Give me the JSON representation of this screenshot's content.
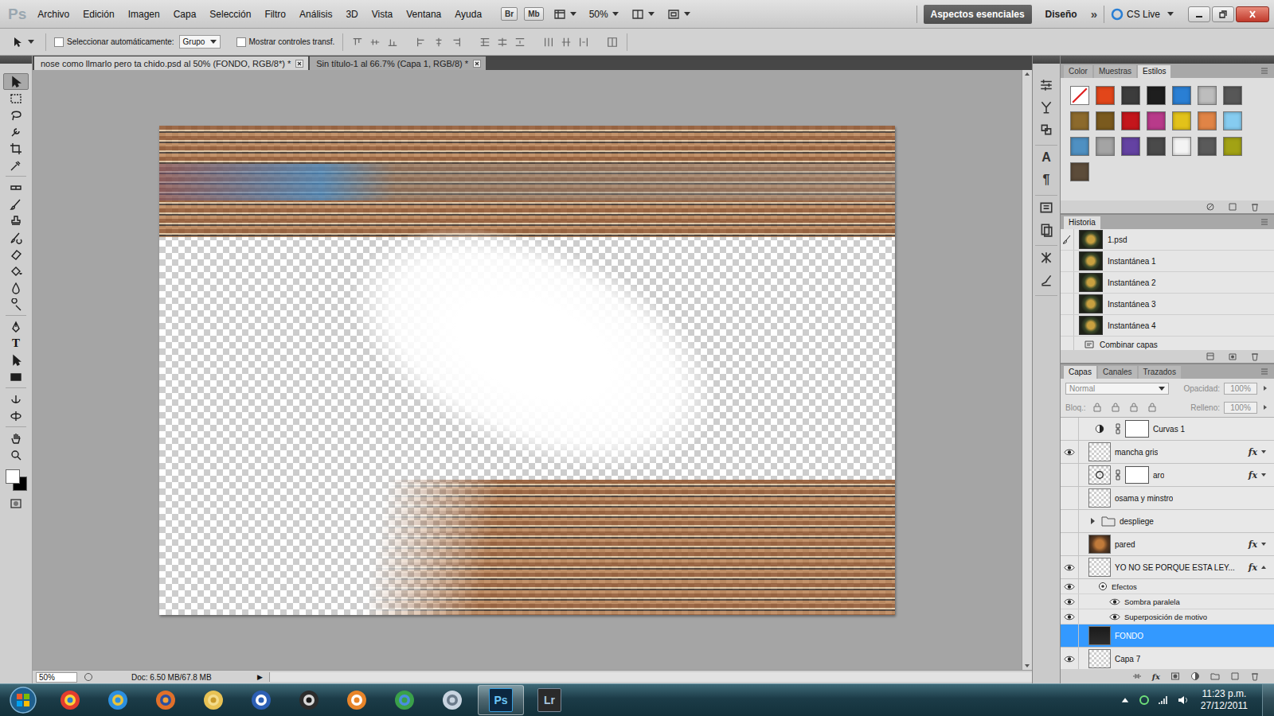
{
  "app": {
    "logo": "Ps"
  },
  "menu": [
    "Archivo",
    "Edición",
    "Imagen",
    "Capa",
    "Selección",
    "Filtro",
    "Análisis",
    "3D",
    "Vista",
    "Ventana",
    "Ayuda"
  ],
  "app_bar": {
    "bridge": "Br",
    "mini_bridge": "Mb",
    "zoom": "50%",
    "workspaces": [
      {
        "label": "Aspectos esenciales",
        "selected": true
      },
      {
        "label": "Diseño",
        "selected": false
      }
    ],
    "more": "»",
    "cs_live": "CS Live"
  },
  "options_bar": {
    "auto_select": {
      "label": "Seleccionar automáticamente:",
      "checked": false
    },
    "auto_select_target": "Grupo",
    "transform_controls": {
      "label": "Mostrar controles transf.",
      "checked": false
    }
  },
  "documents": [
    {
      "label": "nose como llmarlo pero ta chido.psd al 50% (FONDO, RGB/8*) *",
      "selected": true
    },
    {
      "label": "Sin título-1 al 66.7% (Capa 1, RGB/8) *",
      "selected": false
    }
  ],
  "toolbar": {
    "type_glyph": "T",
    "foreground": "#ffffff",
    "background": "#000000"
  },
  "status_bar": {
    "zoom": "50%",
    "doc": "Doc: 6.50 MB/67.8 MB",
    "menu": "▶"
  },
  "right_dock": {
    "glyphs": [
      "A",
      "¶"
    ]
  },
  "styles_panel": {
    "tabs": [
      {
        "label": "Color",
        "selected": false
      },
      {
        "label": "Muestras",
        "selected": false
      },
      {
        "label": "Estilos",
        "selected": true
      }
    ],
    "swatches": [
      {
        "kind": "none",
        "color": "#ffffff"
      },
      {
        "kind": "fill",
        "color": "#e2461a"
      },
      {
        "kind": "fill",
        "color": "#3c3c3c"
      },
      {
        "kind": "fill",
        "color": "#1e1e1e"
      },
      {
        "kind": "fill",
        "color": "#2a7fd4"
      },
      {
        "kind": "fill",
        "color": "#bdbdbd"
      },
      {
        "kind": "fill",
        "color": "#575757"
      },
      {
        "kind": "fill",
        "color": "#8c6a2c"
      },
      {
        "kind": "fill",
        "color": "#7a5a1e"
      },
      {
        "kind": "fill",
        "color": "#c4161c"
      },
      {
        "kind": "fill",
        "color": "#b83a8a"
      },
      {
        "kind": "fill",
        "color": "#e2c21a"
      },
      {
        "kind": "fill",
        "color": "#e08446"
      },
      {
        "kind": "fill",
        "color": "#86ccf0"
      },
      {
        "kind": "fill",
        "color": "#4f90c2"
      },
      {
        "kind": "fill",
        "color": "#a4a4a4"
      },
      {
        "kind": "fill",
        "color": "#6442a2"
      },
      {
        "kind": "fill",
        "color": "#4a4a4a"
      },
      {
        "kind": "fill",
        "color": "#f4f4f4"
      },
      {
        "kind": "fill",
        "color": "#5a5a5a"
      },
      {
        "kind": "fill",
        "color": "#a2a214"
      },
      {
        "kind": "fill",
        "color": "#5c4c3a"
      }
    ]
  },
  "history": {
    "title": "Historia",
    "items": [
      {
        "kind": "snapshot",
        "label": "1.psd",
        "source": true,
        "selected": false
      },
      {
        "kind": "snapshot",
        "label": "Instantánea 1",
        "source": false,
        "selected": false
      },
      {
        "kind": "snapshot",
        "label": "Instantánea 2",
        "source": false,
        "selected": false
      },
      {
        "kind": "snapshot",
        "label": "Instantánea 3",
        "source": false,
        "selected": false
      },
      {
        "kind": "snapshot",
        "label": "Instantánea 4",
        "source": false,
        "selected": false
      },
      {
        "kind": "step",
        "label": "Combinar capas",
        "source": false,
        "selected": false
      }
    ]
  },
  "layers_panel": {
    "tabs": [
      {
        "label": "Capas",
        "selected": true
      },
      {
        "label": "Canales",
        "selected": false
      },
      {
        "label": "Trazados",
        "selected": false
      }
    ],
    "blend_mode": {
      "value": "Normal",
      "disabled": true
    },
    "opacity": {
      "label": "Opacidad:",
      "value": "100%",
      "disabled": true
    },
    "lock": {
      "label": "Bloq.:"
    },
    "fill": {
      "label": "Relleno:",
      "value": "100%",
      "disabled": true
    },
    "fx_label": "fx",
    "layers": [
      {
        "kind": "adjustment",
        "name": "Curvas 1",
        "visible": false,
        "selected": false,
        "mask": true,
        "fx": false,
        "expanded": false,
        "thumb": "adjustment"
      },
      {
        "kind": "layer",
        "name": "mancha gris",
        "visible": true,
        "selected": false,
        "mask": false,
        "fx": true,
        "expanded": false,
        "thumb": "checker"
      },
      {
        "kind": "layer",
        "name": "aro",
        "visible": false,
        "selected": false,
        "mask": true,
        "fx": true,
        "expanded": false,
        "thumb": "ring"
      },
      {
        "kind": "layer",
        "name": "osama y minstro",
        "visible": false,
        "selected": false,
        "mask": false,
        "fx": false,
        "expanded": false,
        "thumb": "checker"
      },
      {
        "kind": "group",
        "name": "despliege",
        "visible": false,
        "selected": false,
        "mask": false,
        "fx": false,
        "expanded": false,
        "thumb": "folder"
      },
      {
        "kind": "layer",
        "name": "pared",
        "visible": false,
        "selected": false,
        "mask": false,
        "fx": true,
        "expanded": false,
        "thumb": "photo"
      },
      {
        "kind": "layer",
        "name": "YO NO SE PORQUE ESTA LEY...",
        "visible": true,
        "selected": false,
        "mask": false,
        "fx": true,
        "expanded": true,
        "thumb": "checker"
      },
      {
        "kind": "effects",
        "name": "Efectos",
        "visible": true,
        "selected": false,
        "mask": false,
        "fx": false,
        "expanded": true,
        "thumb": "none"
      },
      {
        "kind": "effect",
        "name": "Sombra paralela",
        "visible": true,
        "selected": false,
        "mask": false,
        "fx": false,
        "expanded": false,
        "thumb": "none"
      },
      {
        "kind": "effect",
        "name": "Superposición de motivo",
        "visible": true,
        "selected": false,
        "mask": false,
        "fx": false,
        "expanded": false,
        "thumb": "none"
      },
      {
        "kind": "layer",
        "name": "FONDO",
        "visible": false,
        "selected": true,
        "mask": false,
        "fx": false,
        "expanded": false,
        "thumb": "dark"
      },
      {
        "kind": "layer",
        "name": "Capa 7",
        "visible": true,
        "selected": false,
        "mask": false,
        "fx": false,
        "expanded": false,
        "thumb": "checker"
      }
    ]
  },
  "taskbar": {
    "pinned": [
      {
        "label": "Ps",
        "selected": true
      },
      {
        "label": "Lr",
        "selected": false
      }
    ],
    "time": "11:23 p.m.",
    "date": "27/12/2011"
  }
}
